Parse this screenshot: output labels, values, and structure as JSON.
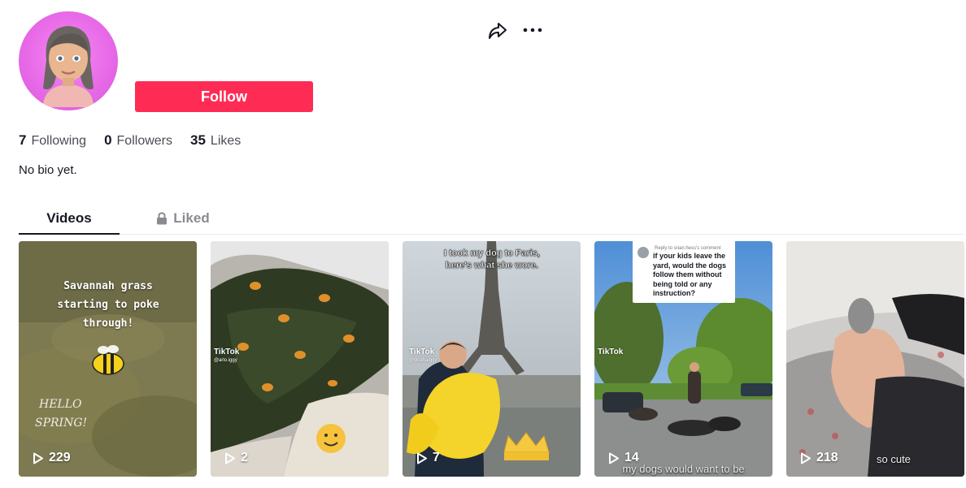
{
  "profile": {
    "follow_label": "Follow",
    "stats": [
      {
        "count": "7",
        "label": "Following"
      },
      {
        "count": "0",
        "label": "Followers"
      },
      {
        "count": "35",
        "label": "Likes"
      }
    ],
    "bio": "No bio yet."
  },
  "actions": {
    "share_icon": "share-arrow-icon",
    "more_icon": "ellipsis-icon"
  },
  "tabs": [
    {
      "label": "Videos",
      "active": true
    },
    {
      "label": "Liked",
      "active": false,
      "icon": "lock-icon"
    }
  ],
  "videos": [
    {
      "views": "229",
      "overlay": [
        "Savannah grass",
        "starting to poke",
        "through!"
      ],
      "sticker": "HELLO SPRING!"
    },
    {
      "views": "2",
      "watermark": "TikTok",
      "handle": "@arlo.iggy"
    },
    {
      "views": "7",
      "overlay": [
        "I took my dog to Paris,",
        "here's what she wore."
      ],
      "watermark": "TikTok",
      "handle": "@tiksthaiggy"
    },
    {
      "views": "14",
      "reply_to": "Reply to srian.hess's comment",
      "question": "if your kids leave the yard, would the dogs follow them without being told or any instruction?",
      "caption": "my dogs would want to be",
      "watermark": "TikTok"
    },
    {
      "views": "218",
      "caption": "so cute"
    }
  ],
  "colors": {
    "accent": "#fe2c55",
    "text": "#161823",
    "muted": "#8a8b91"
  }
}
